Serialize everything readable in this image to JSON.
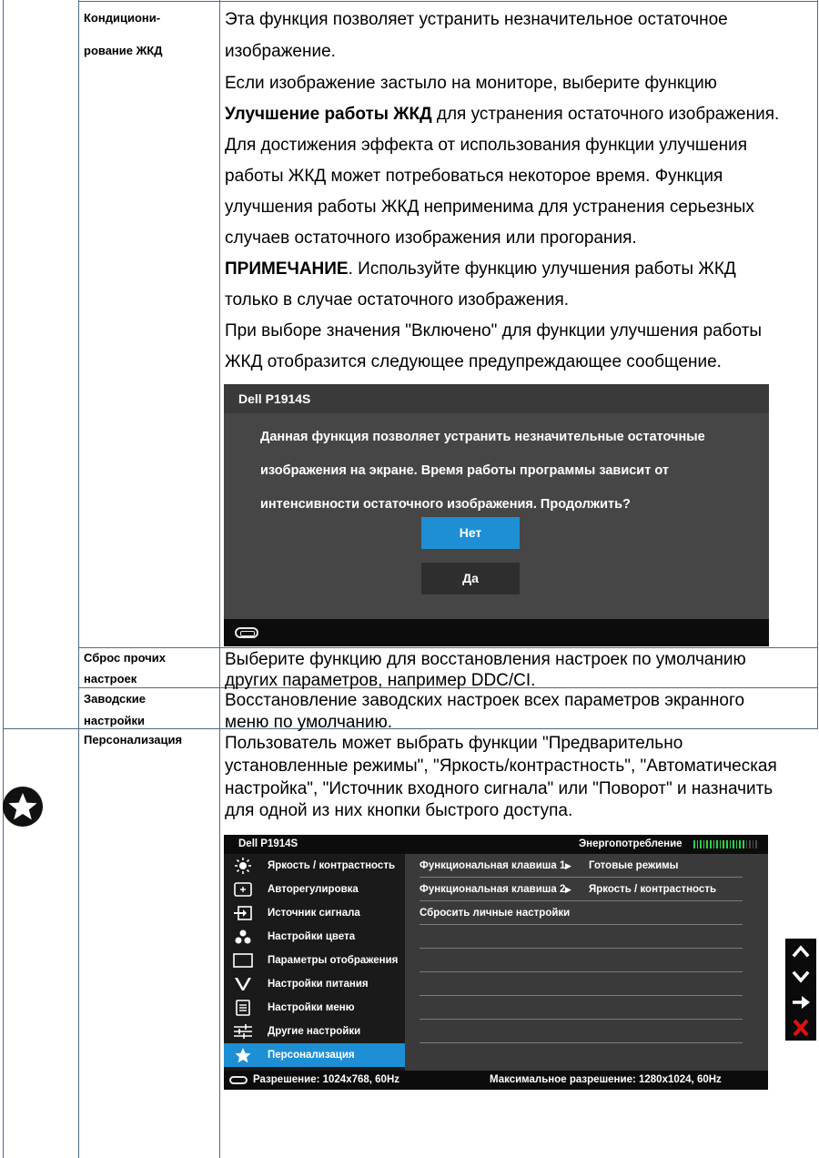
{
  "rows": {
    "lcd": {
      "label_line1": "Кондициони-",
      "label_line2": "рование ЖКД",
      "p1_line1": "Эта функция позволяет устранить незначительное остаточное",
      "p1_line2": "изображение.",
      "p2_line1": "Если изображение застыло на мониторе, выберите функцию",
      "p2_bold": "Улучшение работы ЖКД",
      "p2_line2_rest": " для устранения остаточного изображения.",
      "p3_line1": "Для достижения эффекта от использования функции улучшения",
      "p3_line2": "работы ЖКД может потребоваться некоторое время. Функция",
      "p3_line3": "улучшения работы ЖКД неприменима для устранения серьезных",
      "p3_line4": "случаев остаточного изображения или прогорания.",
      "note_bold": "ПРИМЕЧАНИЕ",
      "note_rest": ". Используйте функцию улучшения работы ЖКД",
      "note_line2": "только в случае остаточного изображения.",
      "p5_line1": "При выборе значения \"Включено\" для функции улучшения работы",
      "p5_line2": "ЖКД отобразится следующее предупреждающее сообщение."
    },
    "reset_other": {
      "label_line1": "Сброс прочих",
      "label_line2": "настроек",
      "desc_line1": "Выберите функцию для восстановления настроек по умолчанию",
      "desc_line2": "других параметров, например DDC/CI."
    },
    "factory": {
      "label_line1": "Заводские",
      "label_line2": "настройки",
      "desc_line1": "Восстановление заводских настроек всех параметров экранного",
      "desc_line2": "меню по умолчанию."
    },
    "personalize": {
      "label": "Персонализация",
      "icon": "star-icon",
      "desc_line1": "Пользователь может выбрать функции \"Предварительно",
      "desc_line2": "установленные режимы\", \"Яркость/контрастность\", \"Автоматическая",
      "desc_line3": "настройка\", \"Источник входного сигнала\" или \"Поворот\" и назначить",
      "desc_line4": "для одной из них кнопки быстрого доступа."
    }
  },
  "warning_dialog": {
    "title": "Dell P1914S",
    "text_line1": "Данная функция позволяет устранить незначительные остаточные",
    "text_line2": "изображения на экране. Время работы программы зависит от",
    "text_line3": "интенсивности остаточного изображения. Продолжить?",
    "no_label": "Нет",
    "yes_label": "Да",
    "footer_icon": "vga-connector-icon",
    "selected_color": "#1e8fd4"
  },
  "osd": {
    "brand": "Dell P1914S",
    "energy_label": "Энергопотребление",
    "energy_level": 0.8,
    "menu": [
      {
        "label": "Яркость / контрастность",
        "icon": "brightness-icon"
      },
      {
        "label": "Авторегулировка",
        "icon": "auto-adjust-icon"
      },
      {
        "label": "Источник сигнала",
        "icon": "input-source-icon"
      },
      {
        "label": "Настройки цвета",
        "icon": "color-dots-icon"
      },
      {
        "label": "Параметры отображения",
        "icon": "display-icon"
      },
      {
        "label": "Настройки питания",
        "icon": "energy-icon"
      },
      {
        "label": "Настройки меню",
        "icon": "menu-icon"
      },
      {
        "label": "Другие настройки",
        "icon": "sliders-icon"
      },
      {
        "label": "Персонализация",
        "icon": "star-icon",
        "active": true
      }
    ],
    "rows": [
      {
        "label": "Функциональная клавиша 1",
        "value": "Готовые режимы"
      },
      {
        "label": "Функциональная клавиша 2",
        "value": "Яркость / контрастность"
      },
      {
        "label": "Сбросить личные настройки",
        "value": ""
      }
    ],
    "resolution": "Разрешение: 1024x768,  60Hz",
    "max_resolution": "Максимальное разрешение: 1280x1024,  60Hz",
    "accent_color": "#1e8fd4",
    "energy_color": "#2ad14b"
  },
  "side_nav": {
    "buttons": [
      "up-arrow-icon",
      "down-arrow-icon",
      "right-arrow-icon",
      "close-icon"
    ]
  }
}
